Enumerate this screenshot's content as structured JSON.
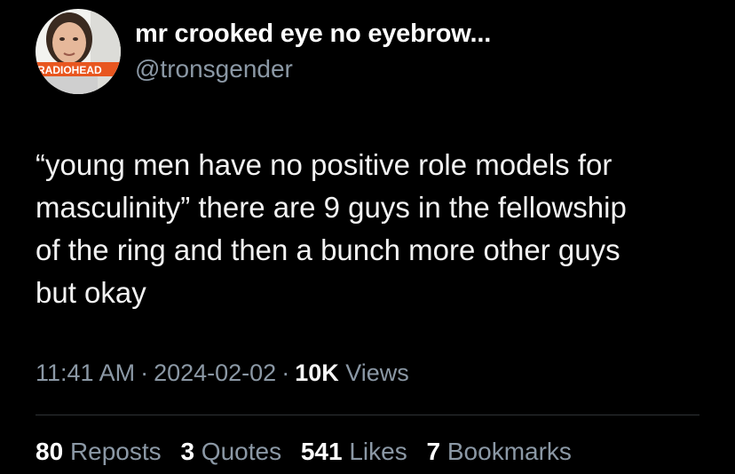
{
  "author": {
    "display_name": "mr crooked eye no eyebrow...",
    "handle": "@tronsgender",
    "avatar_text": "RADIOHEAD"
  },
  "tweet": {
    "lines": [
      "“young men have no positive role models for",
      "masculinity” there are 9 guys in the fellowship",
      "of the ring and then a bunch more other guys",
      "but okay"
    ]
  },
  "meta": {
    "time": "11:41 AM",
    "separator": "·",
    "date": "2024-02-02",
    "views_count": "10K",
    "views_label": "Views"
  },
  "stats": {
    "reposts": {
      "count": "80",
      "label": "Reposts"
    },
    "quotes": {
      "count": "3",
      "label": "Quotes"
    },
    "likes": {
      "count": "541",
      "label": "Likes"
    },
    "bookmarks": {
      "count": "7",
      "label": "Bookmarks"
    }
  },
  "colors": {
    "background": "#000000",
    "text_primary": "#ffffff",
    "text_secondary": "#8b98a5",
    "divider": "#2f3336",
    "avatar_banner": "#e8561f"
  }
}
